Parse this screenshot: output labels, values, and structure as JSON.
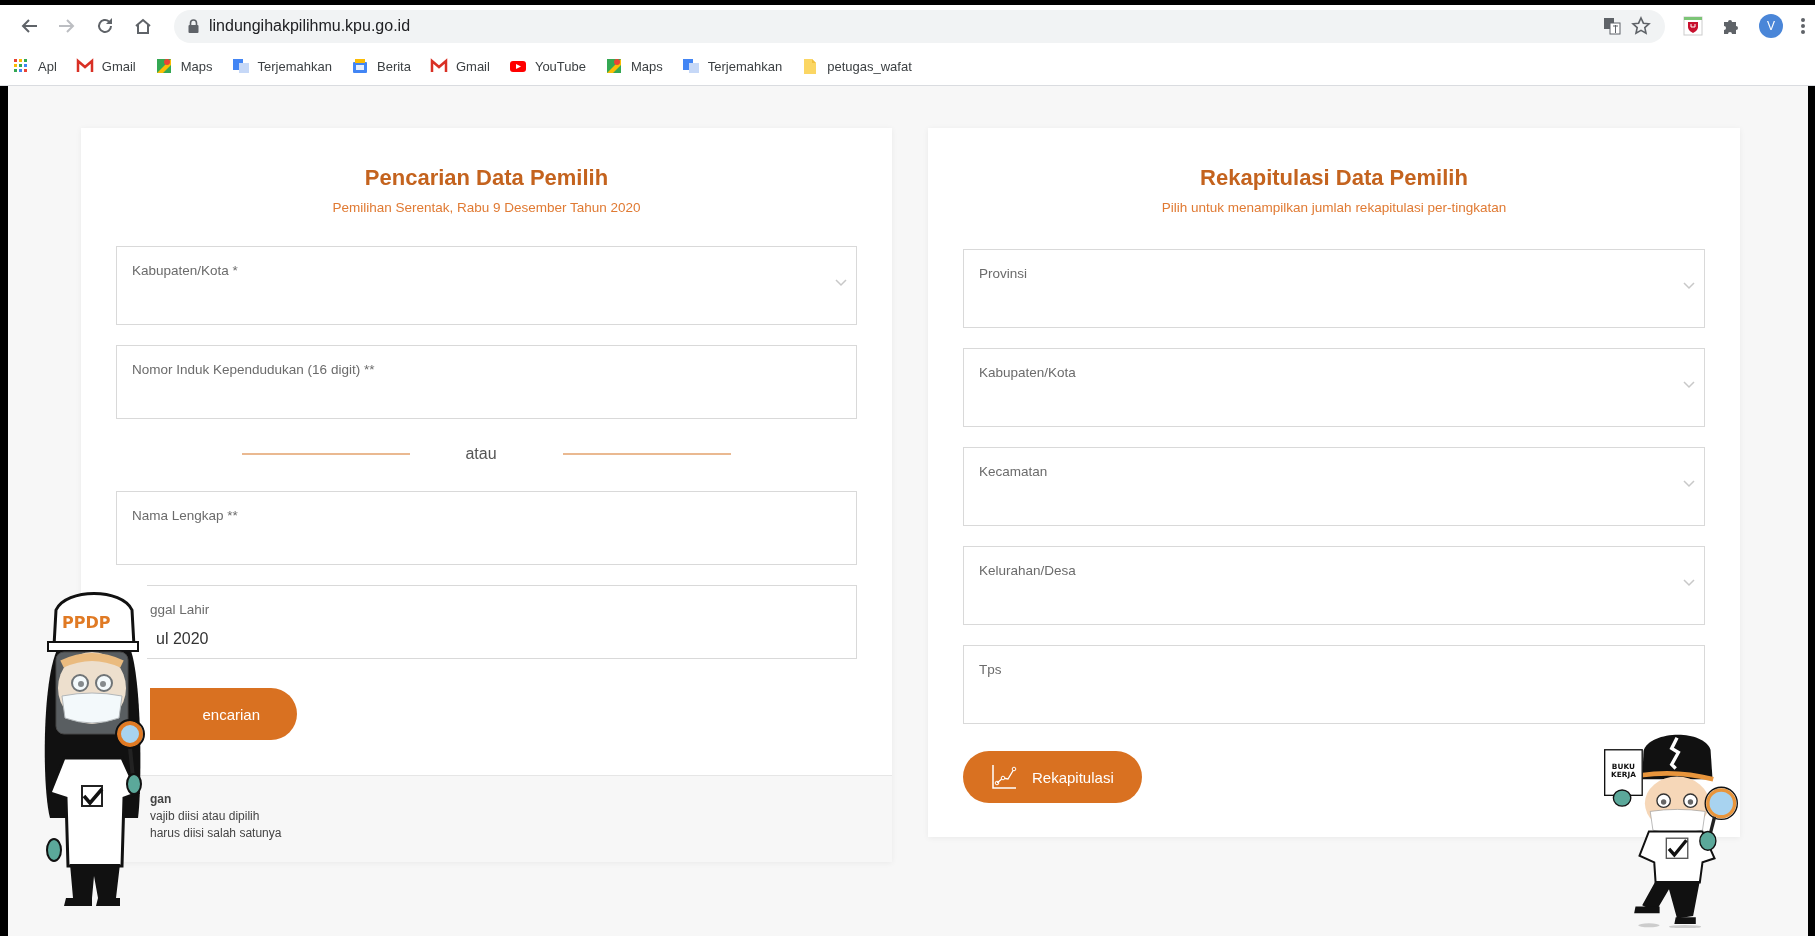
{
  "browser": {
    "nav": [
      {
        "kind": "back",
        "disabled": false
      },
      {
        "kind": "forward",
        "disabled": true
      },
      {
        "kind": "reload",
        "disabled": false
      },
      {
        "kind": "home",
        "disabled": false
      }
    ],
    "url": "lindungihakpilihmu.kpu.go.id",
    "profile_initial": "V",
    "bookmarks": [
      {
        "kind": "apps",
        "label": "Apl"
      },
      {
        "kind": "gmail",
        "label": "Gmail"
      },
      {
        "kind": "maps",
        "label": "Maps"
      },
      {
        "kind": "translate",
        "label": "Terjemahkan"
      },
      {
        "kind": "news",
        "label": "Berita"
      },
      {
        "kind": "gmail",
        "label": "Gmail"
      },
      {
        "kind": "youtube",
        "label": "YouTube"
      },
      {
        "kind": "maps",
        "label": "Maps"
      },
      {
        "kind": "translate",
        "label": "Terjemahkan"
      },
      {
        "kind": "folder",
        "label": "petugas_wafat"
      }
    ]
  },
  "search_card": {
    "title": "Pencarian Data Pemilih",
    "subtitle": "Pemilihan Serentak, Rabu 9 Desember Tahun 2020",
    "fields": [
      {
        "kind": "select",
        "label": "Kabupaten/Kota *",
        "covered": false
      },
      {
        "kind": "text",
        "label": "Nomor Induk Kependudukan (16 digit) **",
        "covered": false
      },
      {
        "kind": "divider",
        "label": "atau"
      },
      {
        "kind": "text",
        "label": "Nama Lengkap **",
        "covered": false
      },
      {
        "kind": "text",
        "label": "ggal Lahir",
        "value": "ul 2020",
        "covered": true
      }
    ],
    "button": {
      "label": "encarian",
      "covered": true
    },
    "notes": {
      "title": "gan",
      "lines": [
        "vajib diisi atau dipilih",
        "harus diisi salah satunya"
      ]
    }
  },
  "recap_card": {
    "title": "Rekapitulasi Data Pemilih",
    "subtitle": "Pilih untuk menampilkan jumlah rekapitulasi per-tingkatan",
    "fields": [
      {
        "kind": "select",
        "label": "Provinsi",
        "covered": false
      },
      {
        "kind": "select",
        "label": "Kabupaten/Kota",
        "covered": false
      },
      {
        "kind": "select",
        "label": "Kecamatan",
        "covered": false
      },
      {
        "kind": "select",
        "label": "Kelurahan/Desa",
        "covered": false
      },
      {
        "kind": "text",
        "label": "Tps",
        "covered": false
      }
    ],
    "button": {
      "label": "Rekapitulasi",
      "covered": false
    }
  },
  "mascots": [
    {
      "kind": "woman",
      "cap_text": "PPDP"
    },
    {
      "kind": "man",
      "sign_lines": [
        "BUKU",
        "KERJA"
      ]
    }
  ]
}
